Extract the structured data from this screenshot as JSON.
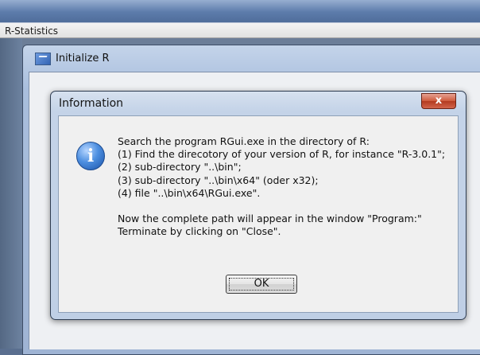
{
  "outer_window": {
    "title": "R-Statistics"
  },
  "inner_window": {
    "title": "Initialize R"
  },
  "dialog": {
    "title": "Information",
    "close_label": "x",
    "icon": "info-icon",
    "icon_glyph": "i",
    "lines": [
      "Search the program RGui.exe in the directory of R:",
      "(1) Find the direcotory of your version of R, for instance \"R-3.0.1\";",
      "(2) sub-directory \"..\\bin\";",
      "(3) sub-directory \"..\\bin\\x64\" (oder x32);",
      "(4) file \"..\\bin\\x64\\RGui.exe\"."
    ],
    "lines2": [
      "Now the complete path will appear in the window \"Program:\"",
      "Terminate by clicking on \"Close\"."
    ],
    "ok_label": "OK"
  }
}
